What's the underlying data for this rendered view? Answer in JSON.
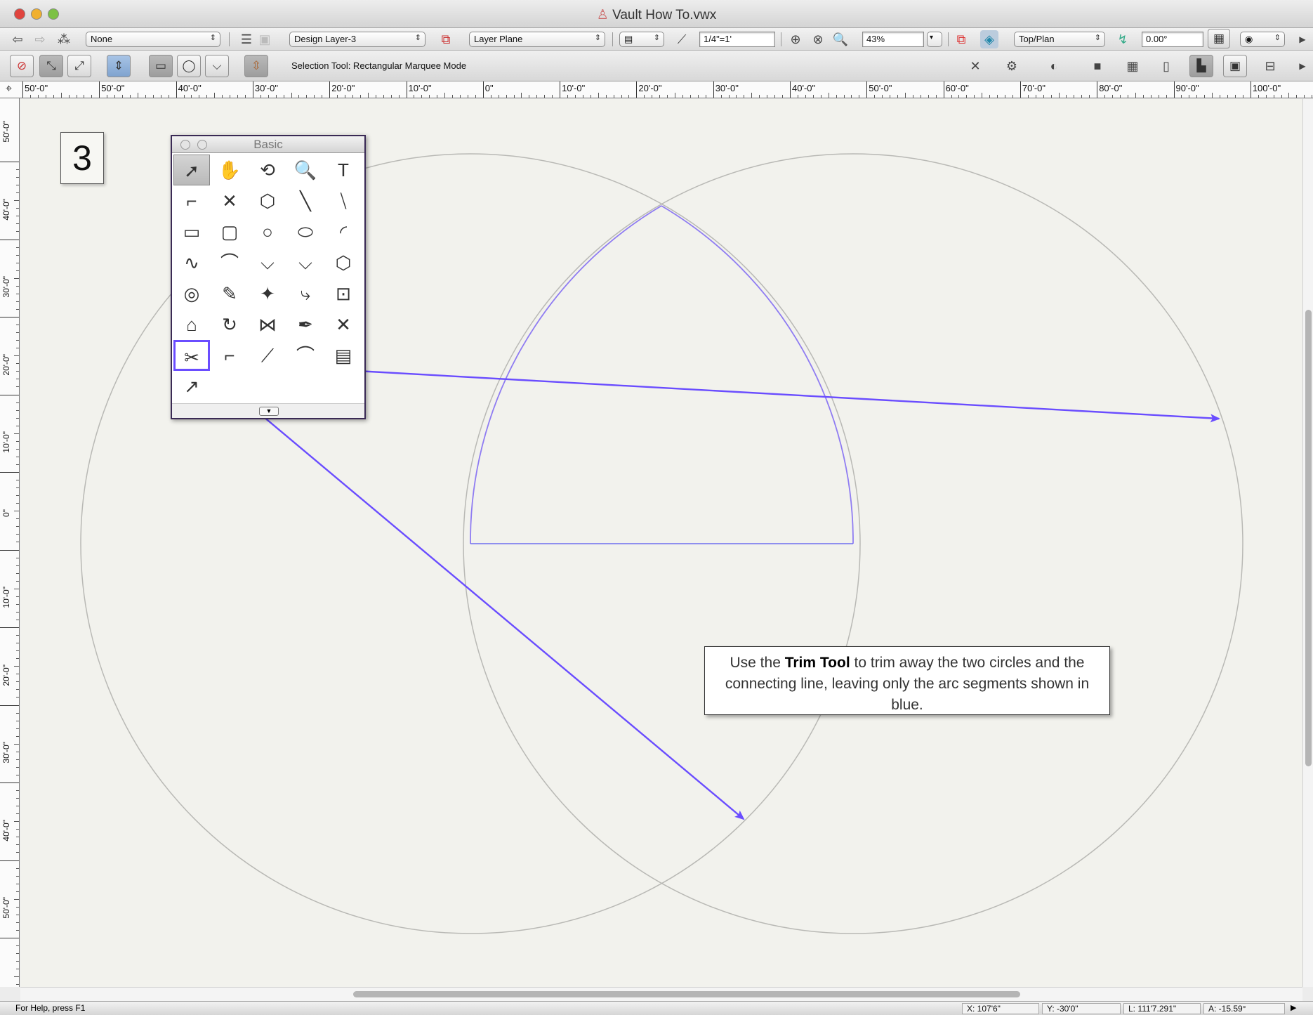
{
  "window": {
    "title": "Vault How To.vwx"
  },
  "toolbar1": {
    "class_popup": "None",
    "layer_popup": "Design Layer-3",
    "plane_popup": "Layer Plane",
    "scale_value": "1/4\"=1'",
    "zoom_value": "43%",
    "view_popup": "Top/Plan",
    "rotation_value": "0.00°"
  },
  "toolbar2": {
    "mode_message": "Selection Tool: Rectangular Marquee Mode"
  },
  "ruler_h": [
    "50'-0\"",
    "50'-0\"",
    "40'-0\"",
    "30'-0\"",
    "20'-0\"",
    "10'-0\"",
    "0\"",
    "10'-0\"",
    "20'-0\"",
    "30'-0\"",
    "40'-0\"",
    "50'-0\"",
    "60'-0\"",
    "70'-0\"",
    "80'-0\"",
    "90'-0\"",
    "100'-0\""
  ],
  "ruler_v": [
    "50'-0\"",
    "40'-0\"",
    "30'-0\"",
    "20'-0\"",
    "10'-0\"",
    "0\"",
    "10'-0\"",
    "20'-0\"",
    "30'-0\"",
    "40'-0\"",
    "50'-0\""
  ],
  "step_number": "3",
  "palette": {
    "title": "Basic",
    "tools": [
      [
        "selection-tool",
        "pan-tool",
        "flyover-tool",
        "zoom-tool",
        "text-tool"
      ],
      [
        "callout-tool",
        "locus-tool",
        "3d-locus-tool",
        "line-tool",
        "double-line-tool"
      ],
      [
        "rectangle-tool",
        "rounded-rectangle-tool",
        "circle-tool",
        "oval-tool",
        "arc-tool"
      ],
      [
        "freehand-tool",
        "polyline-tool",
        "polygon-tool",
        "double-line-polygon-tool",
        "regular-polygon-tool"
      ],
      [
        "spiral-tool",
        "eyedropper-tool",
        "magic-wand-tool",
        "visibility-tool",
        "reshape-tool"
      ],
      [
        "offset-tool",
        "rotate-tool",
        "mirror-tool",
        "split-tool",
        "connect-combine-tool"
      ],
      [
        "trim-tool",
        "fillet-tool",
        "chamfer-tool",
        "clip-tool",
        "eraser-tool"
      ],
      [
        "move-by-points-tool"
      ]
    ],
    "glyphs": [
      [
        "➚",
        "✋",
        "⟲",
        "🔍",
        "T"
      ],
      [
        "⌐",
        "✕",
        "⬡",
        "╲",
        "⧹"
      ],
      [
        "▭",
        "▢",
        "○",
        "⬭",
        "◜"
      ],
      [
        "∿",
        "⌒",
        "⌵",
        "⌵",
        "⬡"
      ],
      [
        "◎",
        "✎",
        "✦",
        "⤷",
        "⊡"
      ],
      [
        "⌂",
        "↻",
        "⋈",
        "✒",
        "✕"
      ],
      [
        "✂",
        "⌐",
        "⟋",
        "⌒",
        "▤"
      ],
      [
        "↗"
      ]
    ]
  },
  "callout": {
    "prefix": "Use the ",
    "bold": "Trim Tool",
    "suffix": " to trim away the two circles and the connecting line, leaving only the arc segments shown in blue."
  },
  "statusbar": {
    "help": "For Help, press F1",
    "x": "X:  107'6\"",
    "y": "Y:  -30'0\"",
    "l": "L:  111'7.291\"",
    "a": "A:  -15.59°"
  },
  "colors": {
    "accent_purple": "#6a4dff",
    "arc_blue": "#8f7cf2",
    "circle_gray": "#b9b9b5",
    "canvas_bg": "#f2f2ed"
  }
}
